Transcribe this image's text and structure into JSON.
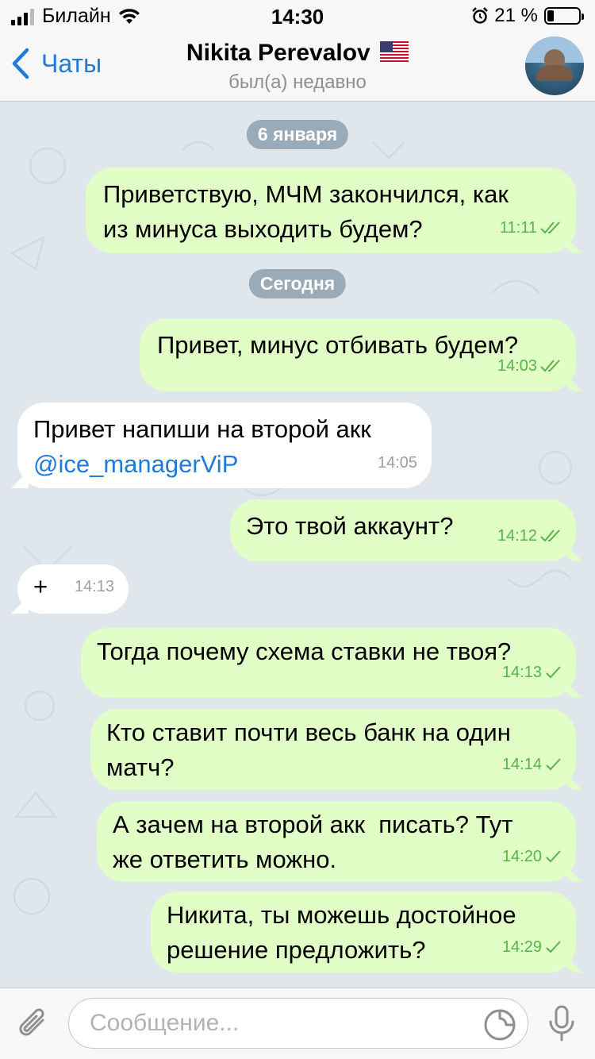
{
  "status_bar": {
    "carrier": "Билайн",
    "time": "14:30",
    "battery": "21 %",
    "battery_level": 0.21
  },
  "nav": {
    "back_label": "Чаты",
    "title": "Nikita Perevalov",
    "subtitle": "был(а) недавно"
  },
  "dates": [
    "6 января",
    "Сегодня"
  ],
  "messages": [
    {
      "dir": "out",
      "text": "Приветствую, МЧМ закончился, как\nиз минуса выходить будем?",
      "time": "11:11",
      "read": true
    },
    {
      "dir": "out",
      "text": "Привет, минус отбивать будем?",
      "time": "14:03",
      "read": true
    },
    {
      "dir": "in",
      "text": "Привет напиши на второй акк",
      "link": "@ice_managerViP",
      "time": "14:05"
    },
    {
      "dir": "out",
      "text": "Это твой аккаунт?",
      "time": "14:12",
      "read": true
    },
    {
      "dir": "in",
      "text": "+",
      "time": "14:13"
    },
    {
      "dir": "out",
      "text": "Тогда почему схема ставки не твоя?",
      "time": "14:13",
      "read": false
    },
    {
      "dir": "out",
      "text": "Кто ставит почти весь банк на один\nматч?",
      "time": "14:14",
      "read": false
    },
    {
      "dir": "out",
      "text": "А зачем на второй акк  писать? Тут\nже ответить можно.",
      "time": "14:20",
      "read": false
    },
    {
      "dir": "out",
      "text": "Никита, ты можешь достойное\nрешение предложить?",
      "time": "14:29",
      "read": false
    }
  ],
  "input": {
    "placeholder": "Сообщение..."
  },
  "icons": {
    "back": "chevron-left-icon",
    "attach": "paperclip-icon",
    "sticker": "sticker-icon",
    "mic": "microphone-icon",
    "read": "double-check-icon",
    "sent": "check-icon"
  },
  "colors": {
    "accent": "#1f7bd9",
    "outgoing_bubble": "#e1fec6",
    "incoming_bubble": "#ffffff",
    "check": "#58b34a",
    "chat_bg": "#dfe6ec"
  }
}
